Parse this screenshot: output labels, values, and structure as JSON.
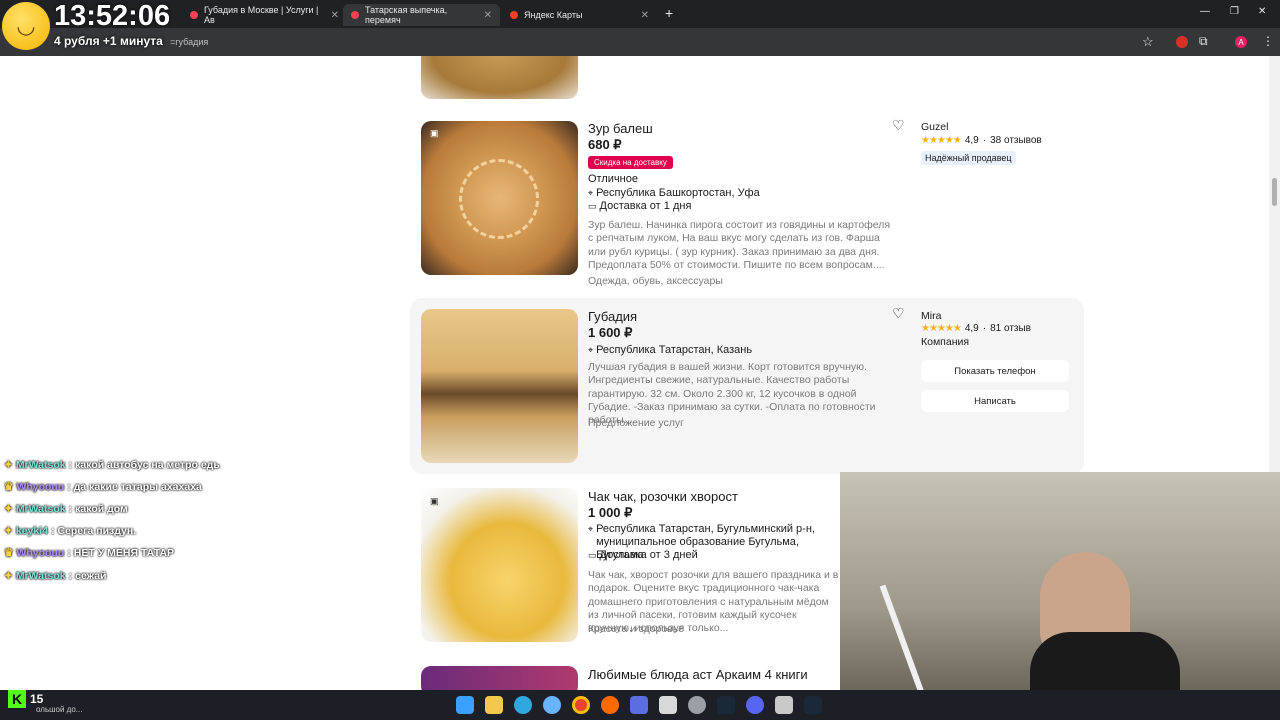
{
  "overlay": {
    "clock": "13:52:06",
    "subclock": "4 рубля +1 минута"
  },
  "browser": {
    "tabs": [
      {
        "label": "Губадия в Москве | Услуги | Ав"
      },
      {
        "label": "Татарская выпечка, перемяч"
      },
      {
        "label": "Яндекс Карты"
      }
    ],
    "url": "=губадия",
    "profile_initial": "A"
  },
  "listings": [
    {
      "title": "Зур балеш",
      "price": "680 ₽",
      "badge": "Скидка на доставку",
      "condition": "Отличное",
      "location": "Республика Башкортостан, Уфа",
      "delivery": "Доставка от 1 дня",
      "desc": "Зур балеш. Начинка пирога состоит из говядины и картофеля с репчатым луком, На ваш вкус могу сделать из гов. Фарша или рубл курицы. ( зур курник). Заказ принимаю за два дня. Предоплата 50% от стоимости. Пишите по всем вопросам....",
      "category": "Одежда, обувь, аксессуары",
      "seller": "Guzel",
      "rating": "4,9",
      "reviews": "38 отзывов",
      "seller_tag": "Надёжный продавец"
    },
    {
      "title": "Губадия",
      "price": "1 600 ₽",
      "location": "Республика Татарстан, Казань",
      "desc": "Лучшая губадия в вашей жизни. Корт готовится вручную. Ингредиенты свежие, натуральные. Качество работы гарантирую. 32 см. Около 2.300 кг, 12 кусочков в одной Губадие. -Заказ принимаю за сутки. -Оплата по готовности работы....",
      "category": "Предложение услуг",
      "seller": "Mira",
      "rating": "4,9",
      "reviews": "81 отзыв",
      "seller_type": "Компания",
      "btn_phone": "Показать телефон",
      "btn_write": "Написать"
    },
    {
      "title": "Чак чак, розочки хворост",
      "price": "1 000 ₽",
      "location": "Республика Татарстан, Бугульминский р-н, муниципальное образование Бугульма, Бугульма",
      "delivery": "Доставка от 3 дней",
      "desc": "Чак чак, хворост розочки для вашего праздника и в подарок. Оцените вкус традиционного чак-чака домашнего приготовления с натуральным мёдом из личной пасеки, готовим каждый кусочек вручную, используя только...",
      "category": "Красота и здоровье"
    },
    {
      "title": "Любимые блюда аст Аркаим 4 книги"
    }
  ],
  "chat": [
    {
      "user": "MrWatsok",
      "text": "какой автобус на метро едь"
    },
    {
      "user": "Whyoouu",
      "text": "да какие татары ахахаха"
    },
    {
      "user": "MrWatsok",
      "text": "какой дом"
    },
    {
      "user": "keyki4",
      "text": "Серега пиздун."
    },
    {
      "user": "Whyoouu",
      "text": "НЕТ У МЕНЯ ТАТАР"
    },
    {
      "user": "MrWatsok",
      "text": "сежай"
    }
  ],
  "taskbar": {
    "kick_count": "15",
    "snippet": "ольшой до..."
  }
}
